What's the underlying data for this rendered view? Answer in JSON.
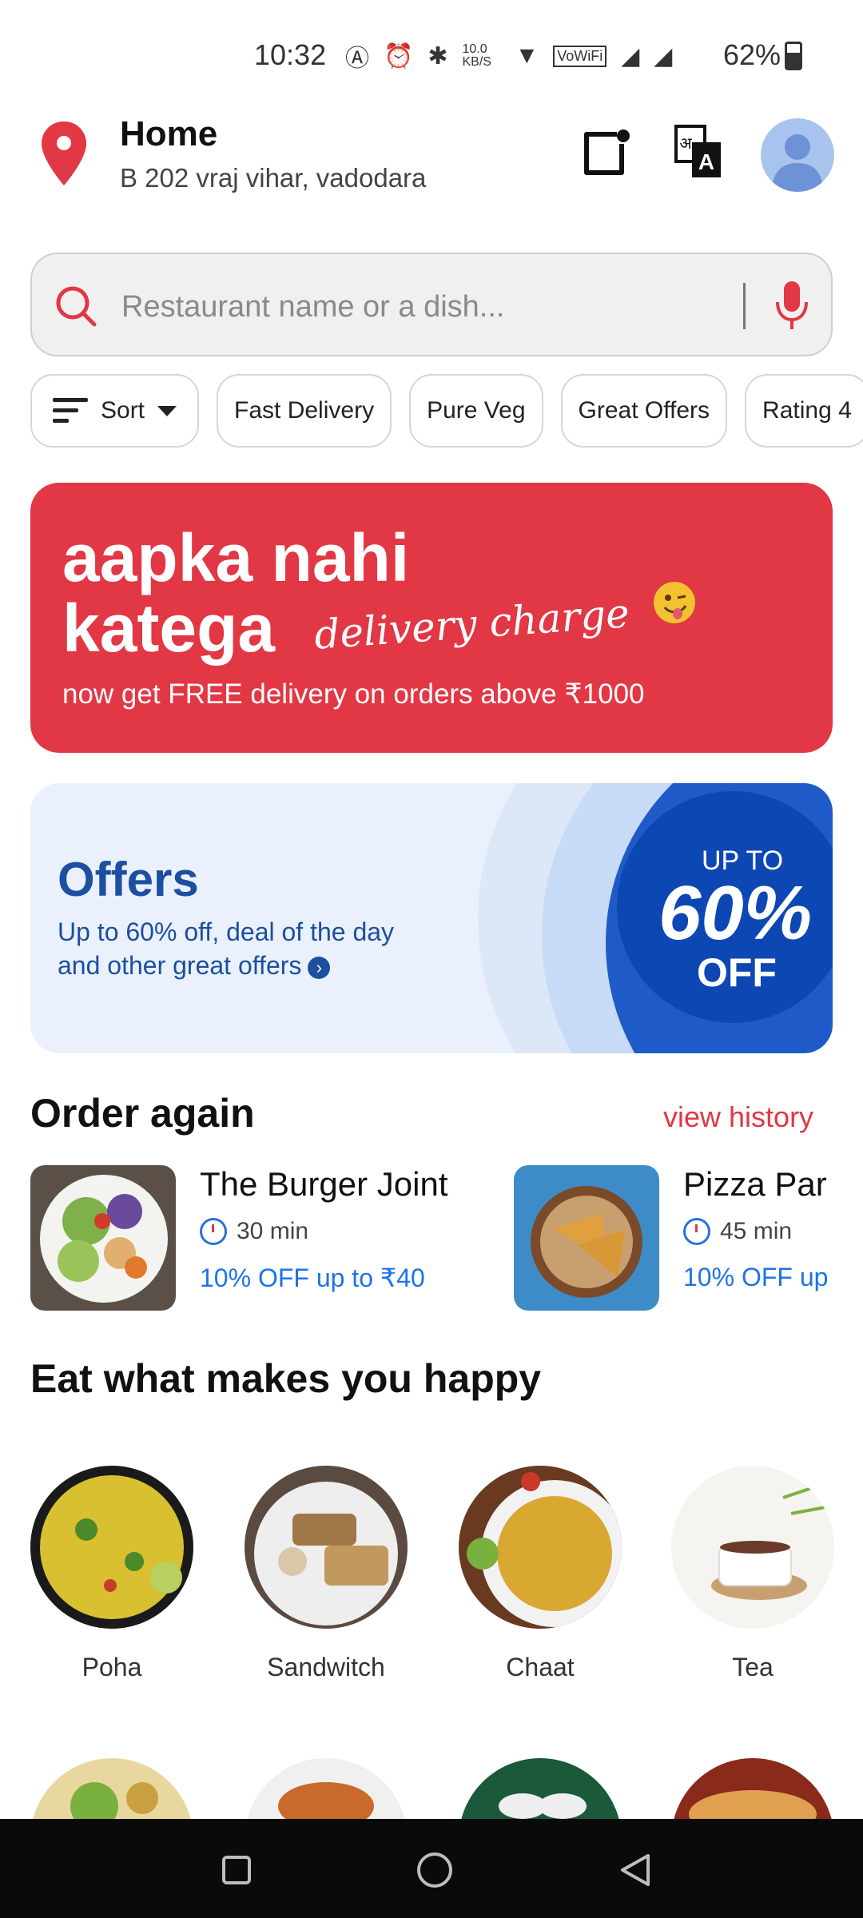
{
  "status_bar": {
    "time": "10:32",
    "net_speed": "10.0 KB/S",
    "battery": "62%"
  },
  "header": {
    "location_title": "Home",
    "location_address": "B 202 vraj vihar, vadodara"
  },
  "search": {
    "placeholder": "Restaurant name or a dish..."
  },
  "filters": {
    "sort_label": "Sort",
    "chips": [
      "Fast Delivery",
      "Pure Veg",
      "Great Offers",
      "Rating 4"
    ]
  },
  "banner_delivery": {
    "line1": "aapka nahi",
    "line2": "katega",
    "script": "delivery charge",
    "subtitle": "now get FREE delivery on orders above ₹1000"
  },
  "banner_offers": {
    "title": "Offers",
    "subtitle_line1": "Up to 60% off, deal of the day",
    "subtitle_line2": "and other great offers",
    "badge_upto": "UP TO",
    "badge_pct": "60%",
    "badge_off": "OFF"
  },
  "order_again": {
    "title": "Order again",
    "view_history": "view history",
    "items": [
      {
        "name": "The Burger Joint",
        "time": "30 min",
        "offer": "10% OFF up to ₹40"
      },
      {
        "name": "Pizza Par",
        "time": "45 min",
        "offer": "10% OFF up"
      }
    ]
  },
  "categories": {
    "title": "Eat what makes you happy",
    "items": [
      "Poha",
      "Sandwitch",
      "Chaat",
      "Tea"
    ]
  },
  "colors": {
    "brand_red": "#e23744",
    "offer_blue": "#1e73e8",
    "offers_navy": "#1c4fa0"
  },
  "icons": [
    "location-pin-icon",
    "notification-icon",
    "language-icon",
    "avatar",
    "search-icon",
    "mic-icon",
    "sort-icon",
    "chevron-down-icon",
    "stopwatch-icon",
    "nav-recents-icon",
    "nav-home-icon",
    "nav-back-icon"
  ]
}
